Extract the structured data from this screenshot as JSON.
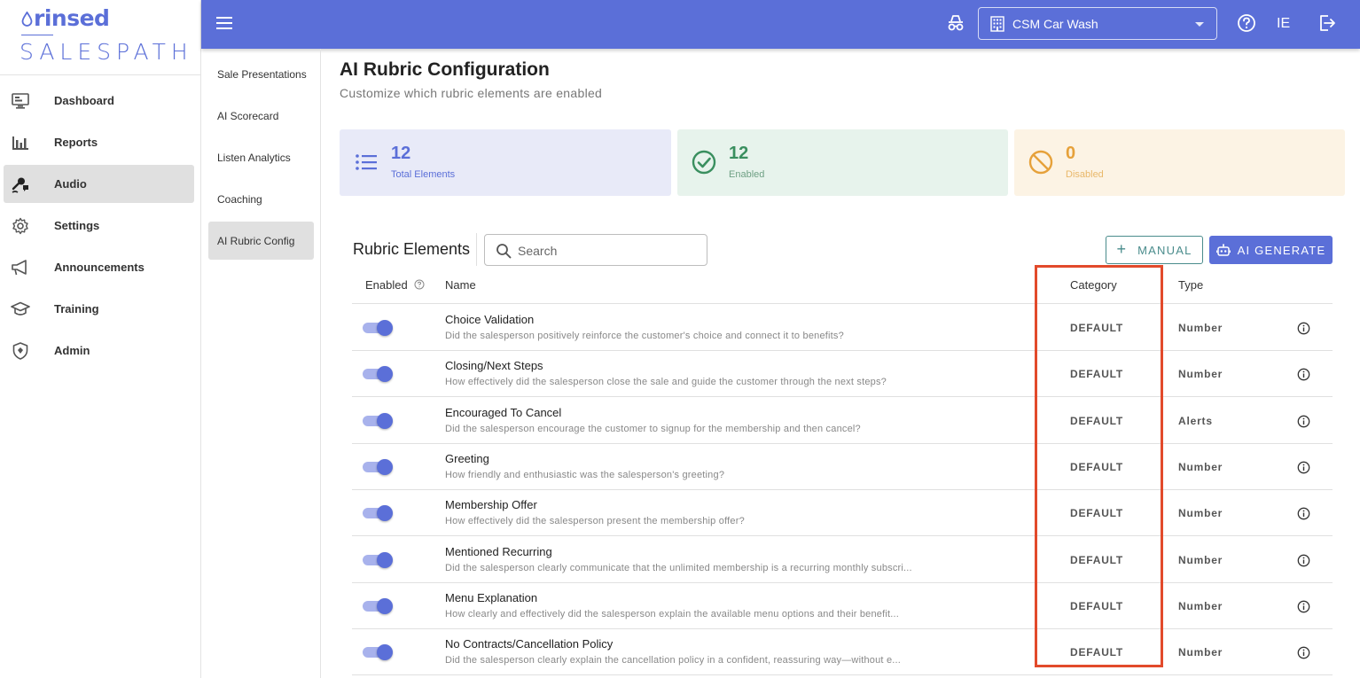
{
  "brand": {
    "top": "rinsed",
    "bottom": "SALESPATH"
  },
  "sidebar": {
    "items": [
      {
        "label": "Dashboard",
        "icon": "monitor-icon"
      },
      {
        "label": "Reports",
        "icon": "bar-chart-icon"
      },
      {
        "label": "Audio",
        "icon": "microphone-icon",
        "active": true
      },
      {
        "label": "Settings",
        "icon": "gear-icon"
      },
      {
        "label": "Announcements",
        "icon": "megaphone-icon"
      },
      {
        "label": "Training",
        "icon": "graduation-cap-icon"
      },
      {
        "label": "Admin",
        "icon": "shield-icon"
      }
    ]
  },
  "topbar": {
    "location": "CSM Car Wash",
    "user_initials": "IE",
    "accent": "#5b6fd8"
  },
  "subnav": {
    "items": [
      {
        "label": "Sale Presentations"
      },
      {
        "label": "AI Scorecard"
      },
      {
        "label": "Listen Analytics"
      },
      {
        "label": "Coaching"
      },
      {
        "label": "AI Rubric Config",
        "active": true
      }
    ]
  },
  "page": {
    "title": "AI Rubric Configuration",
    "subtitle": "Customize which rubric elements are enabled"
  },
  "stats": {
    "total": {
      "value": "12",
      "label": "Total Elements"
    },
    "enabled": {
      "value": "12",
      "label": "Enabled"
    },
    "disabled": {
      "value": "0",
      "label": "Disabled"
    }
  },
  "rubric": {
    "section_title": "Rubric Elements",
    "search_placeholder": "Search",
    "manual_label": "MANUAL",
    "ai_generate_label": "AI GENERATE",
    "columns": {
      "enabled": "Enabled",
      "name": "Name",
      "category": "Category",
      "type": "Type"
    },
    "rows": [
      {
        "enabled": true,
        "name": "Choice Validation",
        "description": "Did the salesperson positively reinforce the customer's choice and connect it to benefits?",
        "category": "DEFAULT",
        "type": "Number"
      },
      {
        "enabled": true,
        "name": "Closing/Next Steps",
        "description": "How effectively did the salesperson close the sale and guide the customer through the next steps?",
        "category": "DEFAULT",
        "type": "Number"
      },
      {
        "enabled": true,
        "name": "Encouraged To Cancel",
        "description": "Did the salesperson encourage the customer to signup for the membership and then cancel?",
        "category": "DEFAULT",
        "type": "Alerts"
      },
      {
        "enabled": true,
        "name": "Greeting",
        "description": "How friendly and enthusiastic was the salesperson's greeting?",
        "category": "DEFAULT",
        "type": "Number"
      },
      {
        "enabled": true,
        "name": "Membership Offer",
        "description": "How effectively did the salesperson present the membership offer?",
        "category": "DEFAULT",
        "type": "Number"
      },
      {
        "enabled": true,
        "name": "Mentioned Recurring",
        "description": "Did the salesperson clearly communicate that the unlimited membership is a recurring monthly subscri...",
        "category": "DEFAULT",
        "type": "Number"
      },
      {
        "enabled": true,
        "name": "Menu Explanation",
        "description": "How clearly and effectively did the salesperson explain the available menu options and their benefit...",
        "category": "DEFAULT",
        "type": "Number"
      },
      {
        "enabled": true,
        "name": "No Contracts/Cancellation Policy",
        "description": "Did the salesperson clearly explain the cancellation policy in a confident, reassuring way—without e...",
        "category": "DEFAULT",
        "type": "Number"
      }
    ]
  },
  "highlight_color": "#e24a2b"
}
